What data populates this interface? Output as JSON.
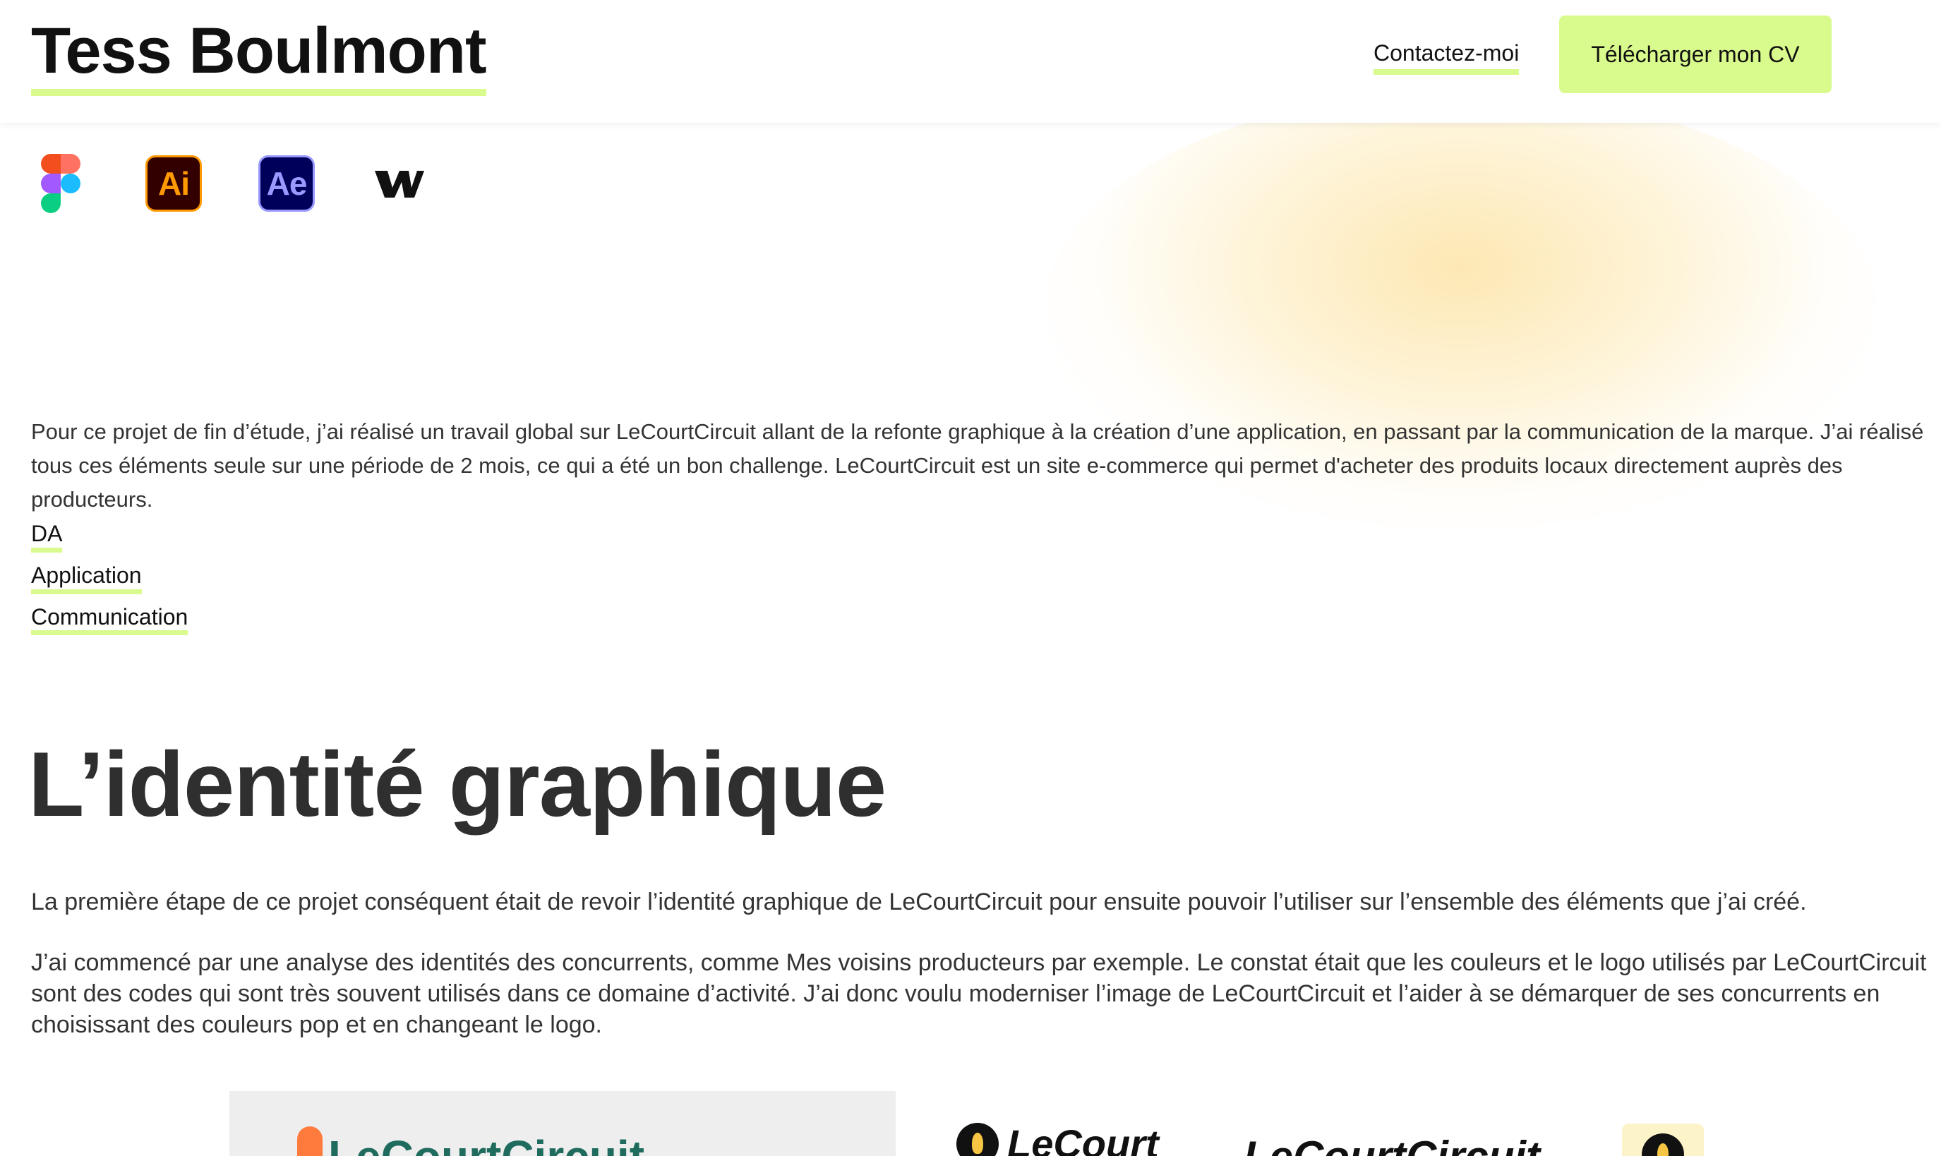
{
  "header": {
    "brand": "Tess Boulmont",
    "contact_label": "Contactez-moi",
    "cv_button_label": "Télécharger mon CV"
  },
  "tools": {
    "icons": [
      "figma-icon",
      "illustrator-icon",
      "after-effects-icon",
      "webflow-icon"
    ],
    "illustrator_label": "Ai",
    "after_effects_label": "Ae",
    "webflow_label": "W"
  },
  "intro": {
    "text": "Pour ce projet de fin d’étude, j’ai réalisé un travail global sur LeCourtCircuit allant de la refonte graphique à la création d’une application, en passant par la communication de la marque. J’ai réalisé tous ces éléments seule sur une période de 2 mois, ce qui a été un bon challenge. LeCourtCircuit est un site e-commerce qui permet d'acheter des produits locaux directement auprès des producteurs."
  },
  "tags": [
    "DA",
    "Application",
    "Communication"
  ],
  "section": {
    "title": "L’identité graphique",
    "paragraph_1": "La première étape de ce projet conséquent était de revoir l’identité graphique de LeCourtCircuit pour ensuite pouvoir l’utiliser sur l’ensemble des éléments que j’ai créé.",
    "paragraph_2": "J’ai commencé par une analyse des identités des concurrents, comme Mes voisins producteurs par exemple. Le constat était que les couleurs et le logo utilisés par LeCourtCircuit sont des codes qui sont très souvent utilisés dans ce domaine d’activité. J’ai donc voulu moderniser l’image de LeCourtCircuit et l’aider à se démarquer de ses concurrents en choisissant des couleurs pop et en changeant le logo."
  },
  "gallery": {
    "logo_old": "LeCourtCircuit",
    "logo_new_stacked": "LeCourt",
    "logo_new_script": "LeCourtCircuit"
  },
  "colors": {
    "accent": "#d9fa8c",
    "glow": "#fde3a0",
    "text": "#2b2b2b"
  }
}
